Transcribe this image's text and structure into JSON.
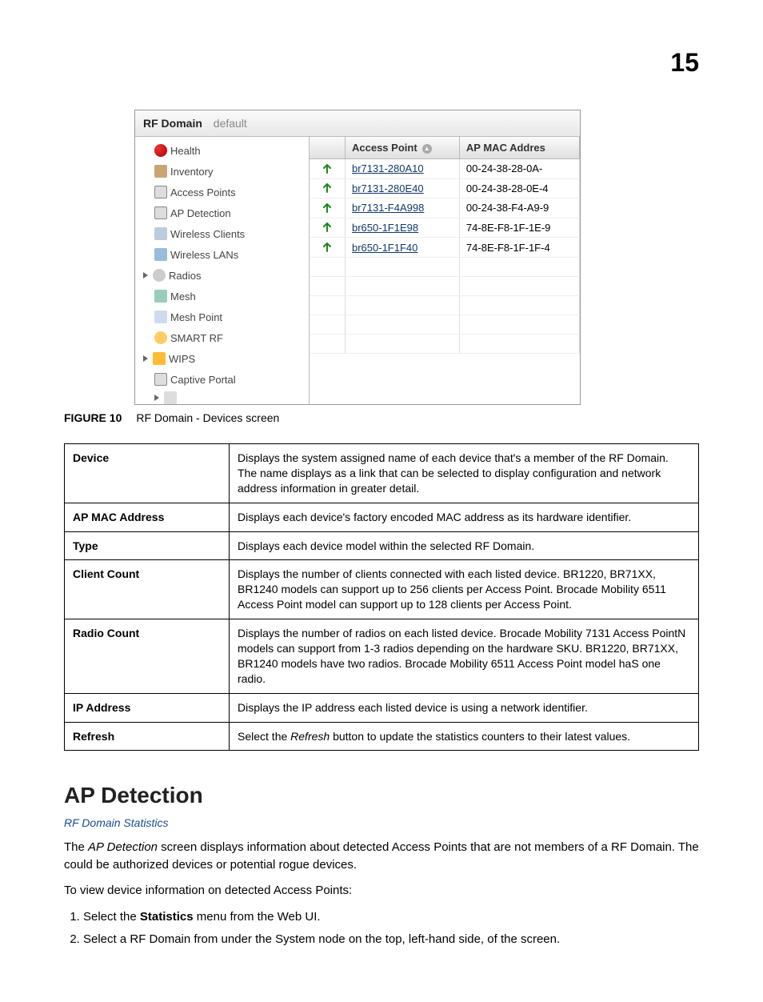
{
  "chapter_number": "15",
  "screenshot": {
    "title_bold": "RF Domain",
    "title_dim": "default",
    "nav": [
      "Health",
      "Inventory",
      "Access Points",
      "AP Detection",
      "Wireless Clients",
      "Wireless LANs",
      "Radios",
      "Mesh",
      "Mesh Point",
      "SMART RF",
      "WIPS",
      "Captive Portal"
    ],
    "col_status": "",
    "col_ap": "Access Point",
    "col_mac": "AP MAC Addres",
    "rows": [
      {
        "name": "br7131-280A10",
        "mac": "00-24-38-28-0A-"
      },
      {
        "name": "br7131-280E40",
        "mac": "00-24-38-28-0E-4"
      },
      {
        "name": "br7131-F4A998",
        "mac": "00-24-38-F4-A9-9"
      },
      {
        "name": "br650-1F1E98",
        "mac": "74-8E-F8-1F-1E-9"
      },
      {
        "name": "br650-1F1F40",
        "mac": "74-8E-F8-1F-1F-4"
      }
    ]
  },
  "figure_label": "FIGURE 10",
  "figure_caption": "RF Domain - Devices screen",
  "desc_rows": [
    {
      "label": "Device",
      "text": "Displays the system assigned name of each device that's a member of the RF Domain. The name displays as a link that can be selected to display configuration and network address information in greater detail."
    },
    {
      "label": "AP MAC Address",
      "text": "Displays each device's factory encoded MAC address as its hardware identifier."
    },
    {
      "label": "Type",
      "text": "Displays each device model within the selected RF Domain."
    },
    {
      "label": "Client Count",
      "text": "Displays the number of clients connected with each listed device. BR1220, BR71XX, BR1240 models can support up to 256 clients per Access Point. Brocade Mobility 6511 Access Point model can support up to 128 clients per Access Point."
    },
    {
      "label": "Radio Count",
      "text": "Displays the number of radios on each listed device. Brocade Mobility 7131 Access PointN models can support from 1-3 radios depending on the hardware SKU. BR1220, BR71XX, BR1240 models have two radios. Brocade Mobility 6511 Access Point model haS one radio."
    },
    {
      "label": "IP Address",
      "text": "Displays the IP address each listed device is using a network identifier."
    },
    {
      "label": "Refresh",
      "text_prefix": "Select the ",
      "text_ital": "Refresh",
      "text_suffix": " button to update the statistics counters to their latest values."
    }
  ],
  "section_heading": "AP Detection",
  "subsection_link": "RF Domain Statistics",
  "para1_prefix": "The ",
  "para1_ital": "AP Detection",
  "para1_suffix": " screen displays information about detected Access Points that are not members of a RF Domain. The could be authorized devices or potential rogue devices.",
  "para2": "To view device information on detected Access Points:",
  "step1_prefix": "Select the ",
  "step1_bold": "Statistics",
  "step1_suffix": " menu from the Web UI.",
  "step2": "Select a RF Domain from under the System node on the top, left-hand side, of the screen."
}
